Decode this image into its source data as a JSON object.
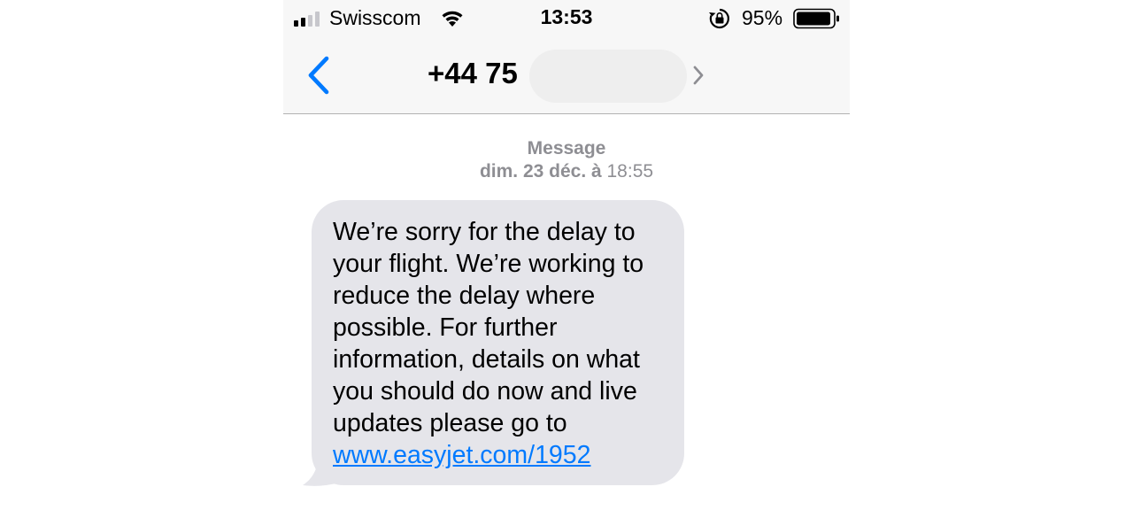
{
  "status_bar": {
    "carrier": "Swisscom",
    "time": "13:53",
    "battery_percent": "95%",
    "battery_level": 0.95,
    "signal_bars": 2,
    "signal_bars_total": 4,
    "icons": [
      "signal-icon",
      "wifi-icon",
      "rotation-lock-icon",
      "battery-icon"
    ]
  },
  "nav": {
    "back_icon": "chevron-left-icon",
    "contact": "+44 75",
    "detail_icon": "chevron-right-icon"
  },
  "conversation": {
    "header": "Message",
    "date_day": "dim. 23 déc. à",
    "date_time": " 18:55",
    "message": {
      "text_before_link": "We’re sorry for the delay to your flight. We’re working to reduce the delay where possible. For further information, details on what you should do now and live updates please go to ",
      "link": "www.easyjet.com/1952"
    }
  },
  "colors": {
    "accent": "#007aff",
    "bubble": "#e5e5ea",
    "meta_text": "#8e8e93",
    "bar_background": "#f7f7f7"
  }
}
